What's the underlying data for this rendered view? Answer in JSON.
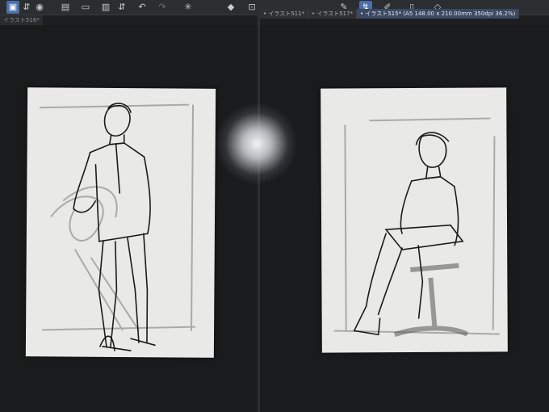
{
  "toolbar": {
    "buttons": [
      {
        "icon": "select-icon",
        "glyph": "▣",
        "active": true
      },
      {
        "icon": "chevrons-icon",
        "glyph": "⇵"
      },
      {
        "icon": "view-icon",
        "glyph": "◉"
      },
      {
        "icon": "new-file-icon",
        "glyph": "▤"
      },
      {
        "icon": "open-folder-icon",
        "glyph": "▭"
      },
      {
        "icon": "save-icon",
        "glyph": "▥"
      },
      {
        "icon": "save-chevron-icon",
        "glyph": "⇵"
      },
      {
        "icon": "undo-icon",
        "glyph": "↶"
      },
      {
        "icon": "redo-icon",
        "glyph": "↷"
      },
      {
        "icon": "brightness-icon",
        "glyph": "✳"
      },
      {
        "icon": "fill-icon",
        "glyph": "◆"
      },
      {
        "icon": "transform-icon",
        "glyph": "⊡"
      },
      {
        "icon": "pen-icon",
        "glyph": "✎"
      },
      {
        "icon": "brush-icon",
        "glyph": "↯",
        "active": true
      },
      {
        "icon": "pencil-icon",
        "glyph": "✐"
      },
      {
        "icon": "ruler-icon",
        "glyph": "▯"
      },
      {
        "icon": "layer-icon",
        "glyph": "◇"
      }
    ]
  },
  "tabs": {
    "left_tab_label": "イラスト516*",
    "items": [
      {
        "label": "イラスト511*"
      },
      {
        "label": "イラスト517*"
      },
      {
        "label": "イラスト515* (A5 148.00 x 210.00mm 350dpi 36.2%)",
        "active": true
      }
    ]
  },
  "colors": {
    "ui_background": "#1d1e20",
    "toolbar": "#2c2d30",
    "accent_tab": "#3b4a63",
    "paper": "#e9e9e7"
  }
}
